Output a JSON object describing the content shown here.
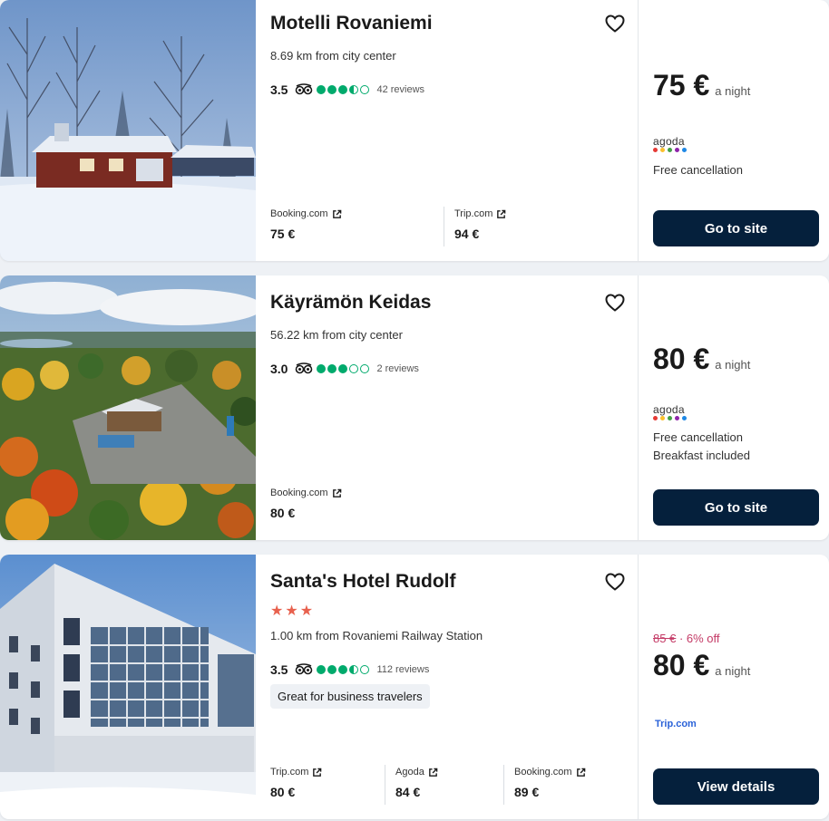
{
  "hotels": [
    {
      "name": "Motelli Rovaniemi",
      "distance": "8.69 km from city center",
      "rating": "3.5",
      "reviews": "42 reviews",
      "providers": [
        {
          "name": "Booking.com",
          "price": "75 €"
        },
        {
          "name": "Trip.com",
          "price": "94 €"
        }
      ],
      "price": "75 €",
      "per_night": "a night",
      "partner": "agoda",
      "features": [
        "Free cancellation"
      ],
      "button": "Go to site"
    },
    {
      "name": "Käyrämön Keidas",
      "distance": "56.22 km from city center",
      "rating": "3.0",
      "reviews": "2 reviews",
      "providers": [
        {
          "name": "Booking.com",
          "price": "80 €"
        }
      ],
      "price": "80 €",
      "per_night": "a night",
      "partner": "agoda",
      "features": [
        "Free cancellation",
        "Breakfast included"
      ],
      "button": "Go to site"
    },
    {
      "name": "Santa's Hotel Rudolf",
      "stars": 3,
      "distance": "1.00 km from Rovaniemi Railway Station",
      "rating": "3.5",
      "reviews": "112 reviews",
      "tag": "Great for business travelers",
      "providers": [
        {
          "name": "Trip.com",
          "price": "80 €"
        },
        {
          "name": "Agoda",
          "price": "84 €"
        },
        {
          "name": "Booking.com",
          "price": "89 €"
        }
      ],
      "old_price": "85 €",
      "discount": "· 6% off",
      "price": "80 €",
      "per_night": "a night",
      "partner": "Trip.com",
      "button": "View details"
    }
  ],
  "icons": {
    "favorite": "heart-outline-icon",
    "tripadvisor": "tripadvisor-owl-icon",
    "external": "external-link-icon"
  },
  "colors": {
    "button_bg": "#05203c",
    "bubble_green": "#00aa6c",
    "star_red": "#e8614e",
    "discount_pink": "#c43a66"
  }
}
